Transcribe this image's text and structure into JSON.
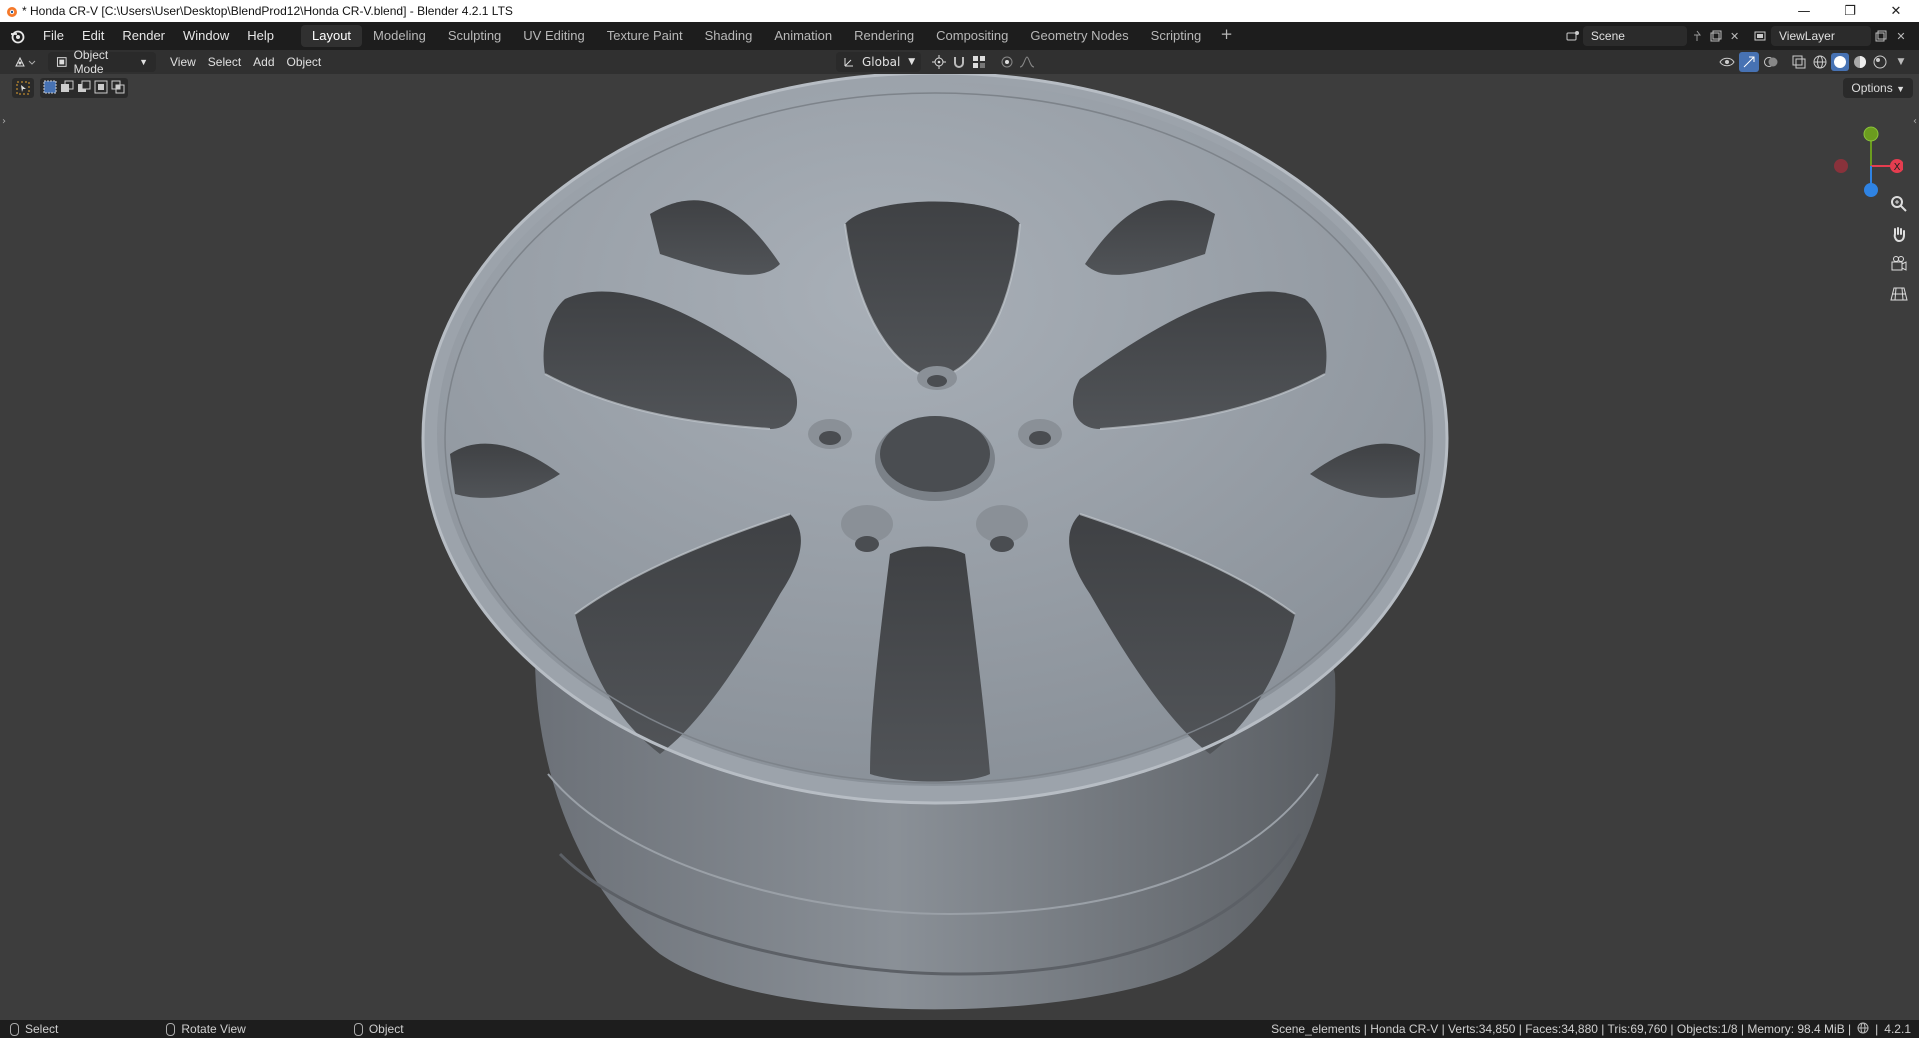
{
  "window": {
    "title": "* Honda CR-V [C:\\Users\\User\\Desktop\\BlendProd12\\Honda CR-V.blend] - Blender 4.2.1 LTS",
    "minimize": "—",
    "maximize": "❐",
    "close": "✕"
  },
  "menu": [
    "File",
    "Edit",
    "Render",
    "Window",
    "Help"
  ],
  "workspaces": [
    "Layout",
    "Modeling",
    "Sculpting",
    "UV Editing",
    "Texture Paint",
    "Shading",
    "Animation",
    "Rendering",
    "Compositing",
    "Geometry Nodes",
    "Scripting"
  ],
  "active_workspace": "Layout",
  "scene": {
    "name": "Scene"
  },
  "view_layer": {
    "name": "ViewLayer"
  },
  "header": {
    "mode": "Object Mode",
    "menus": [
      "View",
      "Select",
      "Add",
      "Object"
    ],
    "orientation": "Global"
  },
  "viewport": {
    "options_label": "Options",
    "gizmo": {
      "x_label": "X"
    }
  },
  "status": {
    "hints": [
      {
        "label": "Select"
      },
      {
        "label": "Rotate View"
      },
      {
        "label": "Object"
      }
    ],
    "stats": "Scene_elements | Honda CR-V | Verts:34,850 | Faces:34,880 | Tris:69,760 | Objects:1/8 | Memory: 98.4 MiB |",
    "version": "4.2.1"
  },
  "colors": {
    "accent": "#4772b3",
    "axis_x": "#e53d4f",
    "axis_y": "#6b9c1f",
    "axis_z": "#2f83e3"
  }
}
